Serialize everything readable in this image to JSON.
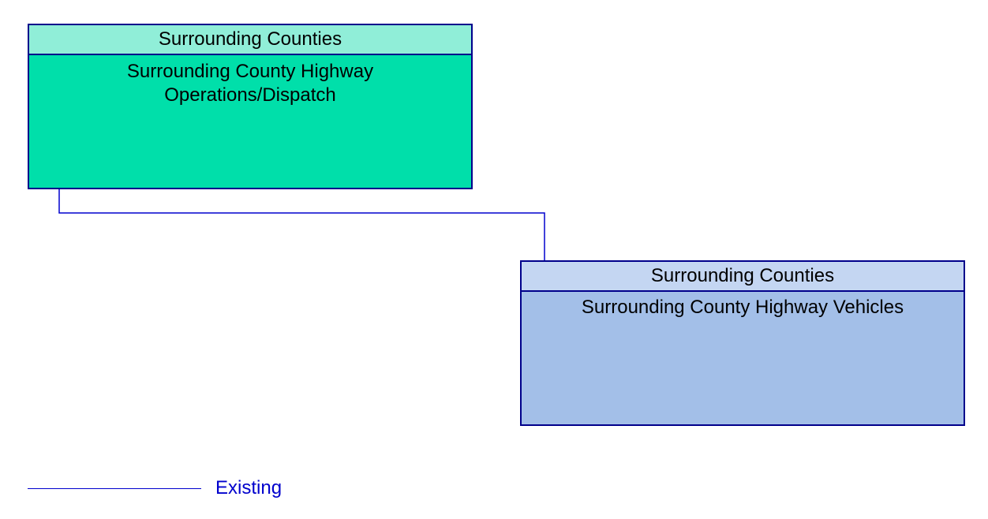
{
  "diagram": {
    "nodes": {
      "a": {
        "header": "Surrounding Counties",
        "body": "Surrounding County Highway Operations/Dispatch",
        "fill_header": "#90eed8",
        "fill_body": "#00dfaa"
      },
      "b": {
        "header": "Surrounding Counties",
        "body": "Surrounding County Highway Vehicles",
        "fill_header": "#c4d6f2",
        "fill_body": "#a3bfe8"
      }
    },
    "connector": {
      "stroke": "#0000cd",
      "type": "existing"
    },
    "legend": {
      "label": "Existing",
      "stroke": "#0000cd"
    }
  }
}
